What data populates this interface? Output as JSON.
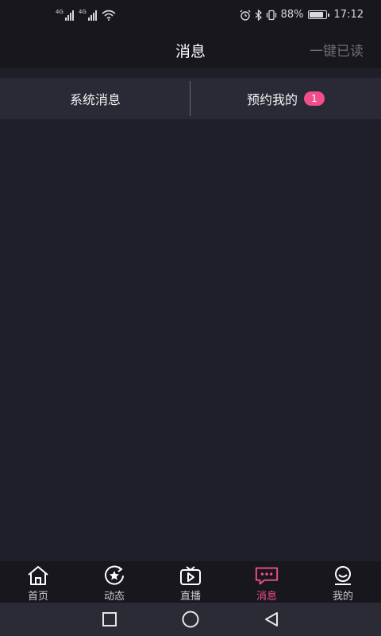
{
  "status_bar": {
    "network_1": "4G",
    "network_2": "4G",
    "battery_text": "88%",
    "battery_level": 0.88,
    "time": "17:12",
    "icons": [
      "signal-icon",
      "signal-icon",
      "wifi-icon",
      "alarm-icon",
      "bluetooth-icon",
      "vibrate-icon",
      "battery-icon"
    ]
  },
  "header": {
    "title": "消息",
    "mark_all_read": "一键已读"
  },
  "tabs": [
    {
      "label": "系统消息"
    },
    {
      "label": "预约我的",
      "badge": "1"
    }
  ],
  "bottom_nav": {
    "items": [
      {
        "label": "首页",
        "icon": "home-icon"
      },
      {
        "label": "动态",
        "icon": "star-refresh-icon"
      },
      {
        "label": "直播",
        "icon": "tv-icon"
      },
      {
        "label": "消息",
        "icon": "message-icon",
        "active": true
      },
      {
        "label": "我的",
        "icon": "profile-icon"
      }
    ]
  },
  "colors": {
    "accent": "#f24f8a",
    "background": "#1f1f29",
    "bar": "#17171d",
    "tab_bar": "#2a2a36"
  },
  "system_nav": {
    "icons": [
      "recent-apps-icon",
      "home-circle-icon",
      "back-triangle-icon"
    ]
  }
}
